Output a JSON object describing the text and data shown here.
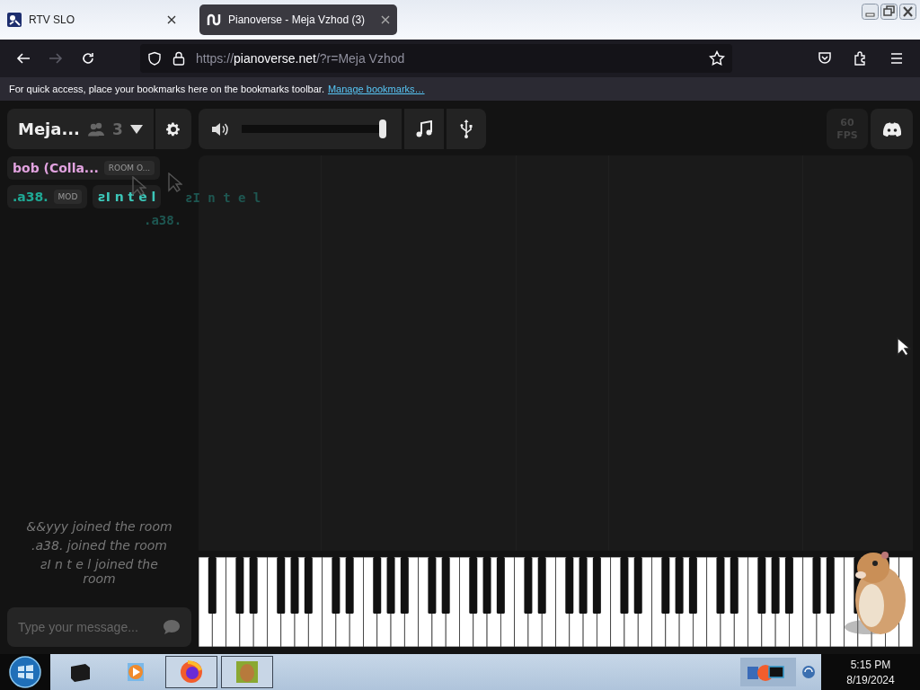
{
  "browser": {
    "tabs": [
      {
        "title": "RTV SLO",
        "selected": false
      },
      {
        "title": "Pianoverse - Meja Vzhod (3)",
        "selected": true
      }
    ],
    "url": {
      "scheme": "https://",
      "domain": "pianoverse.net",
      "rest": "/?r=Meja Vzhod"
    },
    "bookmarks_bar": {
      "message": "For quick access, place your bookmarks here on the bookmarks toolbar.",
      "link": "Manage bookmarks…"
    }
  },
  "room": {
    "name": "Meja...",
    "user_count": "3"
  },
  "volume": {
    "level": 0.98
  },
  "fps": {
    "value": "60",
    "unit": "FPS"
  },
  "users": [
    {
      "name": "bob (Colla...",
      "badge": "ROOM O...",
      "color": "#e2a3e0"
    },
    {
      "name": ".a38.",
      "badge": "MOD",
      "color": "#1fa894"
    },
    {
      "name": "ƨI n t e l",
      "color": "#3cc6b8"
    }
  ],
  "cursors": [
    {
      "label": ".a38."
    },
    {
      "label": "ƨI n t e l"
    }
  ],
  "chat": {
    "messages": [
      "&&yyy joined the room",
      ".a38. joined the room",
      "ƨI n t e l joined the room"
    ],
    "placeholder": "Type your message..."
  },
  "taskbar": {
    "time": "5:15 PM",
    "date": "8/19/2024"
  }
}
